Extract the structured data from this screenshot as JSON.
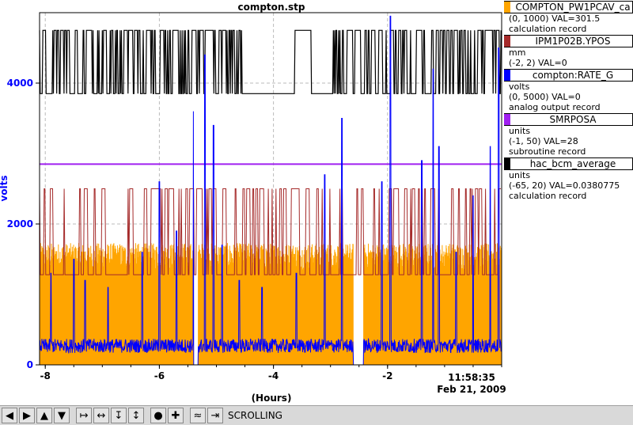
{
  "chart_data": {
    "type": "line",
    "title": "compton.stp",
    "xlabel": "(Hours)",
    "ylabel": "volts",
    "xlim": [
      -8.1,
      0
    ],
    "ylim": [
      0,
      5000
    ],
    "x_ticks": [
      -8,
      -6,
      -4,
      -2
    ],
    "x_tick_labels": [
      "-8",
      "-6",
      "-4",
      "-2"
    ],
    "y_ticks": [
      0,
      2000,
      4000
    ],
    "y_tick_labels": [
      "0",
      "2000",
      "4000"
    ],
    "end_time": "11:58:35",
    "end_date": "Feb 21, 2009",
    "grid": true,
    "series": [
      {
        "name": "COMPTON_PW1PCAV_ca",
        "color": "#ffa500",
        "approx_range": [
          0,
          1700
        ]
      },
      {
        "name": "IPM1P02B.YPOS",
        "color": "#a52a2a",
        "approx_levels": [
          1280,
          2500
        ]
      },
      {
        "name": "compton:RATE_G",
        "color": "#0000ff",
        "approx_baseline": 250,
        "approx_spike_max": 5000
      },
      {
        "name": "SMRPOSA",
        "color": "#a020f0",
        "approx_value": 2850
      },
      {
        "name": "hac_bcm_average",
        "color": "#000000",
        "approx_levels": [
          3850,
          4750
        ]
      }
    ]
  },
  "legend": [
    {
      "name": "COMPTON_PW1PCAV_ca",
      "color": "#ffa500",
      "lines": [
        "(0, 1000) VAL=301.5",
        "calculation record"
      ]
    },
    {
      "name": "IPM1P02B.YPOS",
      "color": "#a52a2a",
      "lines": [
        "mm",
        "(-2, 2) VAL=0"
      ]
    },
    {
      "name": "compton:RATE_G",
      "color": "#0000ff",
      "lines": [
        "volts",
        "(0, 5000) VAL=0",
        "analog output record"
      ]
    },
    {
      "name": "SMRPOSA",
      "color": "#a020f0",
      "lines": [
        "units",
        "(-1, 50) VAL=28",
        "subroutine record"
      ]
    },
    {
      "name": "hac_bcm_average",
      "color": "#000000",
      "lines": [
        "units",
        "(-65, 20) VAL=0.0380775",
        "calculation record"
      ]
    }
  ],
  "toolbar": {
    "icons": [
      "arrow-left-icon",
      "arrow-right-icon",
      "arrow-up-icon",
      "arrow-down-icon",
      "zoom-in-horizontal-icon",
      "zoom-out-horizontal-icon",
      "zoom-in-vertical-icon",
      "zoom-out-vertical-icon",
      "record-icon",
      "add-icon",
      "scroll-icon",
      "export-icon"
    ],
    "mode_label": "SCROLLING"
  }
}
